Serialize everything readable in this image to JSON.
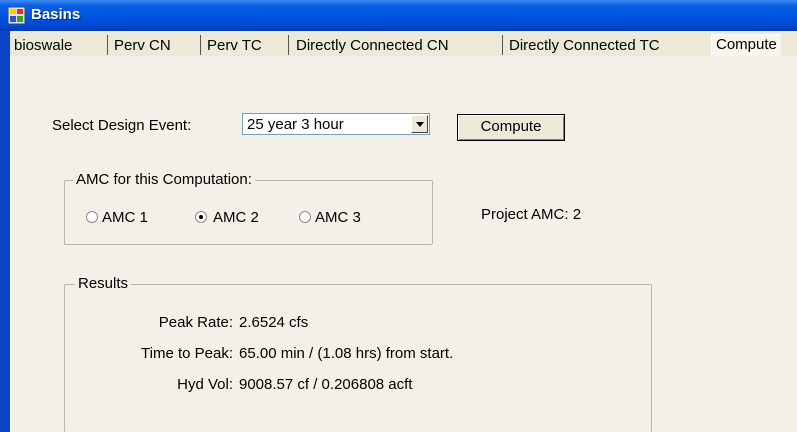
{
  "window": {
    "title": "Basins"
  },
  "tabs": [
    {
      "label": "bioswale"
    },
    {
      "label": "Perv CN"
    },
    {
      "label": "Perv TC"
    },
    {
      "label": "Directly Connected CN"
    },
    {
      "label": "Directly Connected TC"
    },
    {
      "label": "Compute"
    }
  ],
  "active_tab": "Compute",
  "design_event": {
    "label": "Select Design Event:",
    "selected": "25 year 3 hour",
    "compute_label": "Compute"
  },
  "amc": {
    "group_title": "AMC for this Computation:",
    "options": [
      {
        "label": "AMC 1",
        "checked": false
      },
      {
        "label": "AMC 2",
        "checked": true
      },
      {
        "label": "AMC 3",
        "checked": false
      }
    ],
    "project_amc_label": "Project AMC: 2"
  },
  "results": {
    "group_title": "Results",
    "rows": [
      {
        "label": "Peak Rate:",
        "value": "2.6524 cfs"
      },
      {
        "label": "Time to Peak:",
        "value": "65.00 min / (1.08 hrs) from start."
      },
      {
        "label": "Hyd Vol:",
        "value": "9008.57 cf / 0.206808 acft"
      }
    ]
  }
}
